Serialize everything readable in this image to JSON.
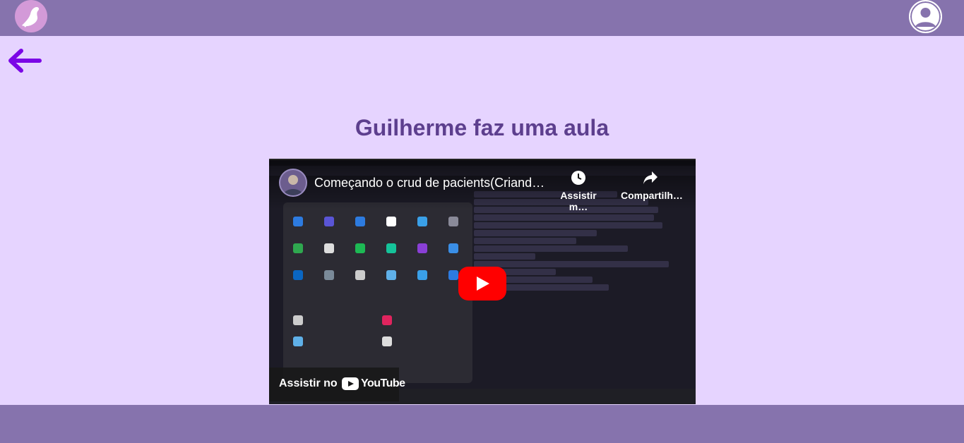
{
  "header": {
    "logo_icon": "bird-logo-icon",
    "profile_icon": "user-avatar-icon"
  },
  "nav": {
    "back_icon": "arrow-left-icon",
    "back_color": "#7b06e6"
  },
  "page": {
    "title": "Guilherme faz uma aula"
  },
  "video": {
    "title": "Começando o crud de pacients(Criand…",
    "actions": [
      {
        "label": "Assistir m…",
        "icon": "clock-icon"
      },
      {
        "label": "Compartilh…",
        "icon": "share-icon"
      }
    ],
    "watch_on_label": "Assistir no",
    "brand_label": "YouTube",
    "play_icon": "play-icon"
  },
  "colors": {
    "bar": "#8673ad",
    "background": "#e6d4ff",
    "title": "#5d3f8e",
    "play": "#ff0000"
  }
}
